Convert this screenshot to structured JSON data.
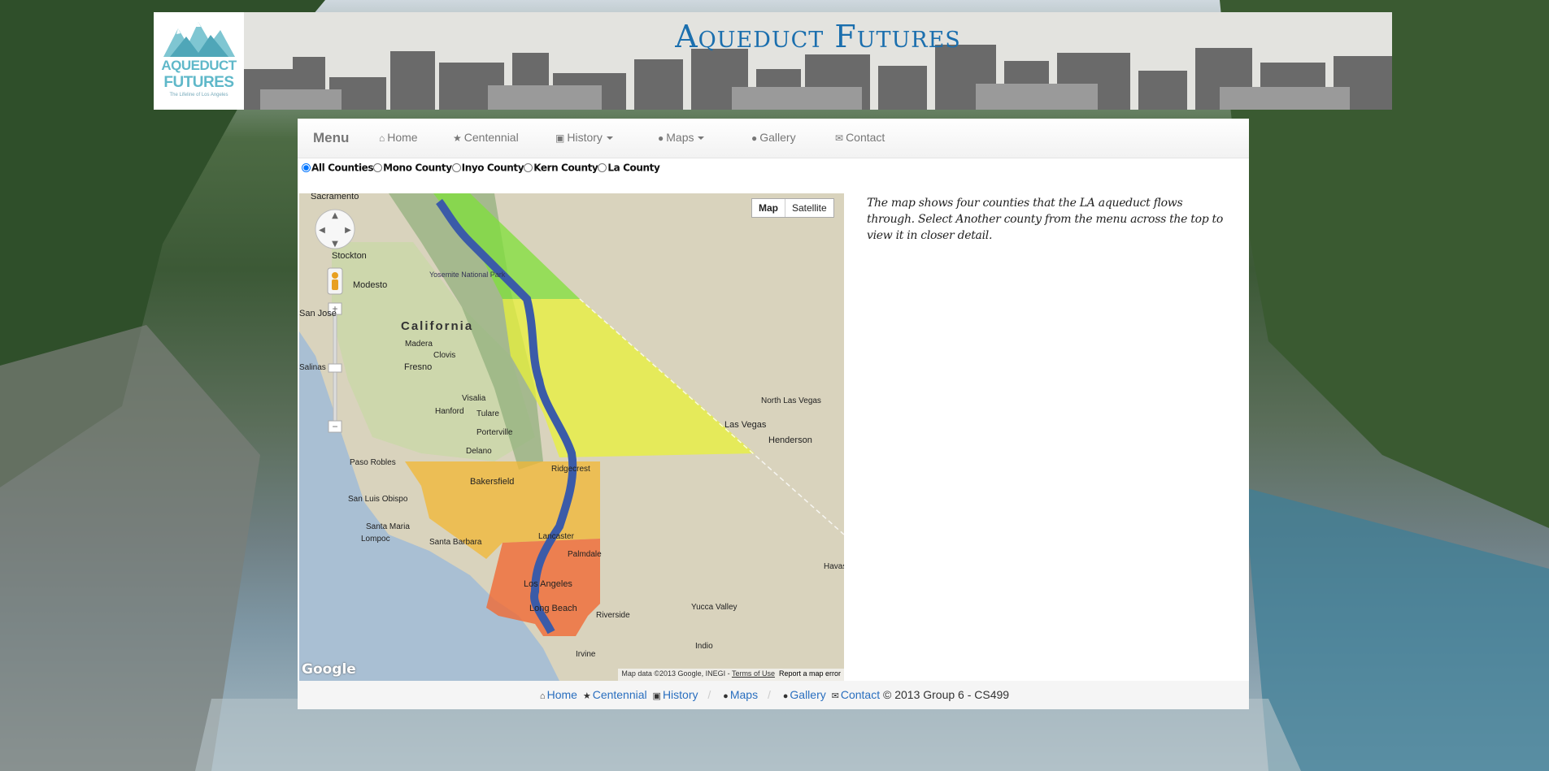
{
  "site": {
    "title": "Aqueduct Futures",
    "logo_line1": "AQUEDUCT",
    "logo_line2": "FUTURES",
    "logo_tagline": "The Lifeline of Los Angeles"
  },
  "nav": {
    "brand": "Menu",
    "items": [
      {
        "icon": "home-icon",
        "label": "Home"
      },
      {
        "icon": "star-icon",
        "label": "Centennial"
      },
      {
        "icon": "picture-icon",
        "label": "History",
        "dropdown": true
      },
      {
        "icon": "map-marker-icon",
        "label": "Maps",
        "dropdown": true
      },
      {
        "icon": "camera-icon",
        "label": "Gallery"
      },
      {
        "icon": "envelope-icon",
        "label": "Contact"
      }
    ]
  },
  "county_filter": {
    "selected": "All Counties",
    "options": [
      "All Counties",
      "Mono County",
      "Inyo County",
      "Kern County",
      "La County"
    ]
  },
  "map": {
    "type_buttons": [
      "Map",
      "Satellite"
    ],
    "active_type": "Map",
    "attribution": "Map data ©2013 Google, INEGI",
    "terms": "Terms of Use",
    "report": "Report a map error",
    "google_logo": "Google",
    "region_label": "California",
    "place_labels": [
      "Sacramento",
      "Stockton",
      "Modesto",
      "San Jose",
      "Madera",
      "Clovis",
      "Fresno",
      "Salinas",
      "Visalia",
      "Hanford",
      "Tulare",
      "Porterville",
      "Delano",
      "Paso Robles",
      "Bakersfield",
      "Ridgecrest",
      "San Luis Obispo",
      "Santa Maria",
      "Lompoc",
      "Santa Barbara",
      "Lancaster",
      "Palmdale",
      "Los Angeles",
      "Long Beach",
      "Riverside",
      "Irvine",
      "Indio",
      "Yucca Valley",
      "North Las Vegas",
      "Las Vegas",
      "Henderson",
      "Havasu",
      "Yosemite National Park"
    ],
    "county_colors": {
      "mono": "#7fe03a",
      "inyo": "#e8f23a",
      "kern": "#f2b733",
      "la": "#f06a35"
    },
    "aqueduct_color": "#3b5ba8"
  },
  "description": "The map shows four counties that the LA aqueduct flows through. Select Another county from the menu across the top to view it in closer detail.",
  "footer": {
    "links": [
      "Home",
      "Centennial",
      "History",
      "Maps",
      "Gallery",
      "Contact"
    ],
    "copyright": "© 2013 Group 6 - CS499"
  }
}
